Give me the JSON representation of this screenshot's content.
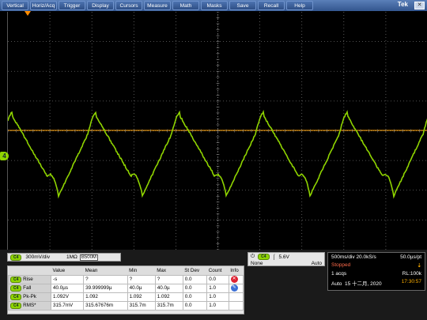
{
  "menubar": {
    "items": [
      "Vertical",
      "Horiz/Acq",
      "Trigger",
      "Display",
      "Cursors",
      "Measure",
      "Math",
      "Masks",
      "Save",
      "Recall",
      "Help"
    ],
    "brand": "Tek",
    "close_label": "✕"
  },
  "channel": {
    "badge": "C4",
    "marker_label": "4",
    "color": "#8fd400",
    "scale": "300mV/div",
    "impedance": "1MΩ",
    "bw_symbol": "B",
    "bandwidth": "500M"
  },
  "trigger": {
    "badge": "C4",
    "level": "5.6V",
    "source_mode": "None",
    "mode": "Auto"
  },
  "horizontal": {
    "timebase": "500ms/div",
    "sample_rate": "20.0kS/s",
    "resolution": "50.0µs/pt",
    "status": "Stopped",
    "acqs": "1 acqs",
    "record_length": "RL:100k",
    "mode": "Auto",
    "date": "15 十二月, 2020",
    "time": "17:30:57"
  },
  "measurements": {
    "headers": [
      "",
      "Value",
      "Mean",
      "Min",
      "Max",
      "St Dev",
      "Count",
      "Info"
    ],
    "rows": [
      {
        "badge": "C4",
        "name": "Rise",
        "value": "-s",
        "mean": "?",
        "min": "?",
        "max": "?",
        "stdev": "0.0",
        "count": "0.0"
      },
      {
        "badge": "C4",
        "name": "Fall",
        "value": "40.0µs",
        "mean": "39.999999µ",
        "min": "40.0µ",
        "max": "40.0µ",
        "stdev": "0.0",
        "count": "1.0"
      },
      {
        "badge": "C4",
        "name": "Pk-Pk",
        "value": "1.092V",
        "mean": "1.092",
        "min": "1.092",
        "max": "1.092",
        "stdev": "0.0",
        "count": "1.0"
      },
      {
        "badge": "C4",
        "name": "RMS*",
        "value": "315.7mV",
        "mean": "315.67676m",
        "min": "315.7m",
        "max": "315.7m",
        "stdev": "0.0",
        "count": "1.0"
      }
    ]
  }
}
